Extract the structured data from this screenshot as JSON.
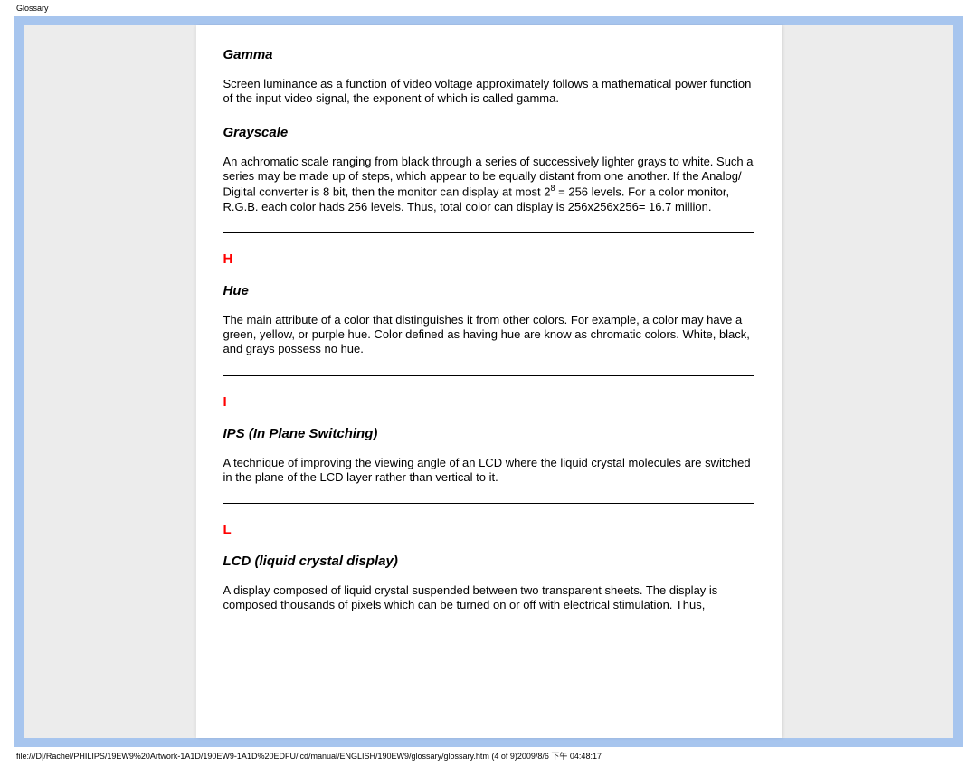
{
  "header": {
    "label": "Glossary"
  },
  "entries": {
    "gamma": {
      "title": "Gamma",
      "body": "Screen luminance as a function of video voltage approximately follows a mathematical power function of the input video signal, the exponent of which is called gamma."
    },
    "grayscale": {
      "title": "Grayscale",
      "body_pre": "An achromatic scale ranging from black through a series of successively lighter grays to white. Such a series may be made up of steps, which appear to be equally distant from one another. If the Analog/ Digital converter is 8 bit, then the monitor can display at most 2",
      "body_sup": "8",
      "body_post": " = 256 levels. For a color monitor, R.G.B. each color hads 256 levels. Thus, total color can display is 256x256x256= 16.7 million."
    },
    "letter_h": "H",
    "hue": {
      "title": "Hue",
      "body": "The main attribute of a color that distinguishes it from other colors. For example, a color may have a green, yellow, or purple hue. Color defined as having hue are know as chromatic colors. White, black, and grays possess no hue."
    },
    "letter_i": "I",
    "ips": {
      "title": "IPS (In Plane Switching)",
      "body": "A technique of improving the viewing angle of an LCD where the liquid crystal molecules are switched in the plane of the LCD layer rather than vertical to it."
    },
    "letter_l": "L",
    "lcd": {
      "title": "LCD (liquid crystal display)",
      "body": "A display composed of liquid crystal suspended between two transparent sheets. The display is composed thousands of pixels which can be turned on or off with electrical stimulation. Thus,"
    }
  },
  "footer": {
    "path": "file:///D|/Rachel/PHILIPS/19EW9%20Artwork-1A1D/190EW9-1A1D%20EDFU/lcd/manual/ENGLISH/190EW9/glossary/glossary.htm (4 of 9)2009/8/6 下午 04:48:17"
  }
}
